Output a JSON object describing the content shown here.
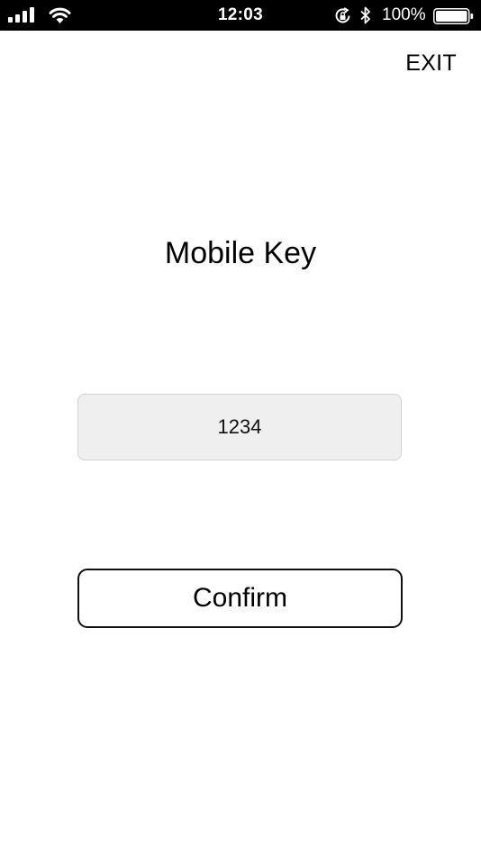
{
  "status_bar": {
    "time": "12:03",
    "battery_percent": "100%",
    "battery_level": 1.0,
    "signal_bars": 4,
    "icons": [
      "signal-icon",
      "wifi-icon",
      "rotation-lock-icon",
      "bluetooth-icon",
      "battery-icon"
    ]
  },
  "header": {
    "exit_label": "EXIT"
  },
  "main": {
    "title": "Mobile Key",
    "key_value": "1234",
    "confirm_label": "Confirm"
  },
  "colors": {
    "status_bar_bg": "#000000",
    "field_bg": "#efefef",
    "field_border": "#d2d2d2",
    "button_border": "#111111",
    "page_bg": "#ffffff"
  }
}
